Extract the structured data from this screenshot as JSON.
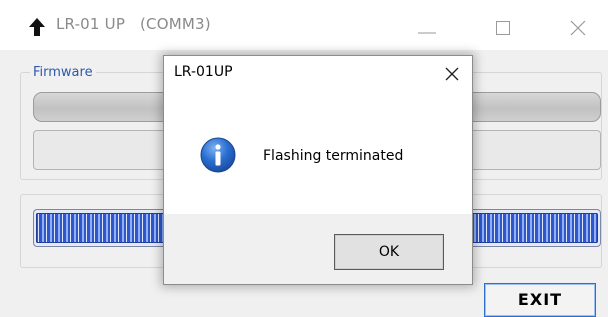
{
  "window": {
    "title": "LR-01 UP   (COMM3)",
    "app_icon": "up-arrow-icon",
    "controls": [
      "minimize-icon",
      "maximize-icon",
      "close-icon"
    ]
  },
  "firmware_group": {
    "label": "Firmware"
  },
  "progress": {
    "fraction": 1.0,
    "color": "#2f57c9"
  },
  "exit_button": {
    "label": "EXIT"
  },
  "dialog": {
    "title": "LR-01UP",
    "message": "Flashing terminated",
    "icon": "info-icon",
    "ok_label": "OK",
    "icon_color": "#1f62c4"
  }
}
